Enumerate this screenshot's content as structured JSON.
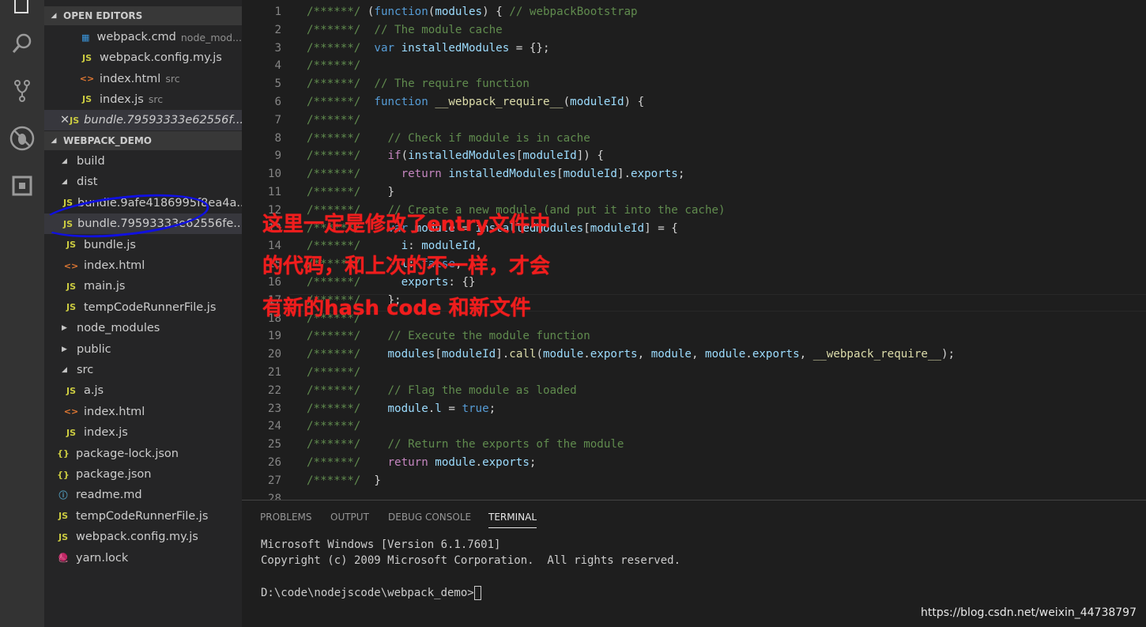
{
  "activity_bar": {
    "icons": [
      "explorer-icon",
      "search-icon",
      "source-control-icon",
      "debug-icon",
      "extensions-icon"
    ]
  },
  "sidebar": {
    "open_editors": {
      "title": "OPEN EDITORS",
      "items": [
        {
          "icon": "windows-icon",
          "name": "webpack.cmd",
          "desc": "node_mod..."
        },
        {
          "icon": "js-icon",
          "name": "webpack.config.my.js",
          "desc": ""
        },
        {
          "icon": "html-icon",
          "name": "index.html",
          "desc": "src"
        },
        {
          "icon": "js-icon",
          "name": "index.js",
          "desc": "src"
        },
        {
          "icon": "js-icon",
          "name": "bundle.79593333e62556f...",
          "desc": "",
          "active": true
        }
      ]
    },
    "project": {
      "title": "WEBPACK_DEMO",
      "items": [
        {
          "type": "folder",
          "name": "build",
          "depth": 1
        },
        {
          "type": "folder",
          "name": "dist",
          "depth": 1
        },
        {
          "type": "js",
          "name": "bundle.9afe4186995f8ea4a...",
          "depth": 2
        },
        {
          "type": "js",
          "name": "bundle.79593333e62556fe...",
          "depth": 2,
          "selected": true
        },
        {
          "type": "js",
          "name": "bundle.js",
          "depth": 2
        },
        {
          "type": "html",
          "name": "index.html",
          "depth": 2
        },
        {
          "type": "js",
          "name": "main.js",
          "depth": 2
        },
        {
          "type": "js",
          "name": "tempCodeRunnerFile.js",
          "depth": 2
        },
        {
          "type": "folder-closed",
          "name": "node_modules",
          "depth": 1
        },
        {
          "type": "folder-closed",
          "name": "public",
          "depth": 1
        },
        {
          "type": "folder",
          "name": "src",
          "depth": 1
        },
        {
          "type": "js",
          "name": "a.js",
          "depth": 2
        },
        {
          "type": "html",
          "name": "index.html",
          "depth": 2
        },
        {
          "type": "js",
          "name": "index.js",
          "depth": 2
        },
        {
          "type": "json",
          "name": "package-lock.json",
          "depth": 1
        },
        {
          "type": "json",
          "name": "package.json",
          "depth": 1
        },
        {
          "type": "info",
          "name": "readme.md",
          "depth": 1
        },
        {
          "type": "js",
          "name": "tempCodeRunnerFile.js",
          "depth": 1
        },
        {
          "type": "js",
          "name": "webpack.config.my.js",
          "depth": 1
        },
        {
          "type": "yarn",
          "name": "yarn.lock",
          "depth": 1
        }
      ]
    }
  },
  "editor": {
    "lines": [
      [
        [
          "c",
          "/******/ "
        ],
        [
          "t",
          "("
        ],
        [
          "k",
          "function"
        ],
        [
          "t",
          "("
        ],
        [
          "v",
          "modules"
        ],
        [
          "t",
          ") { "
        ],
        [
          "c",
          "// webpackBootstrap"
        ]
      ],
      [
        [
          "c",
          "/******/  // The module cache"
        ]
      ],
      [
        [
          "c",
          "/******/  "
        ],
        [
          "k",
          "var"
        ],
        [
          "t",
          " "
        ],
        [
          "v",
          "installedModules"
        ],
        [
          "t",
          " = {};"
        ]
      ],
      [
        [
          "c",
          "/******/"
        ]
      ],
      [
        [
          "c",
          "/******/  // The require function"
        ]
      ],
      [
        [
          "c",
          "/******/  "
        ],
        [
          "k",
          "function"
        ],
        [
          "t",
          " "
        ],
        [
          "f",
          "__webpack_require__"
        ],
        [
          "t",
          "("
        ],
        [
          "v",
          "moduleId"
        ],
        [
          "t",
          ") {"
        ]
      ],
      [
        [
          "c",
          "/******/"
        ]
      ],
      [
        [
          "c",
          "/******/    // Check if module is in cache"
        ]
      ],
      [
        [
          "c",
          "/******/    "
        ],
        [
          "p",
          "if"
        ],
        [
          "t",
          "("
        ],
        [
          "v",
          "installedModules"
        ],
        [
          "t",
          "["
        ],
        [
          "v",
          "moduleId"
        ],
        [
          "t",
          "]) {"
        ]
      ],
      [
        [
          "c",
          "/******/      "
        ],
        [
          "p",
          "return"
        ],
        [
          "t",
          " "
        ],
        [
          "v",
          "installedModules"
        ],
        [
          "t",
          "["
        ],
        [
          "v",
          "moduleId"
        ],
        [
          "t",
          "]."
        ],
        [
          "v",
          "exports"
        ],
        [
          "t",
          ";"
        ]
      ],
      [
        [
          "c",
          "/******/    "
        ],
        [
          "t",
          "}"
        ]
      ],
      [
        [
          "c",
          "/******/    // Create a new module (and put it into the cache)"
        ]
      ],
      [
        [
          "c",
          "/******/    "
        ],
        [
          "k",
          "var"
        ],
        [
          "t",
          " "
        ],
        [
          "v",
          "module"
        ],
        [
          "t",
          " = "
        ],
        [
          "v",
          "installedModules"
        ],
        [
          "t",
          "["
        ],
        [
          "v",
          "moduleId"
        ],
        [
          "t",
          "] = {"
        ]
      ],
      [
        [
          "c",
          "/******/      "
        ],
        [
          "v",
          "i"
        ],
        [
          "t",
          ": "
        ],
        [
          "v",
          "moduleId"
        ],
        [
          "t",
          ","
        ]
      ],
      [
        [
          "c",
          "/******/      "
        ],
        [
          "v",
          "l"
        ],
        [
          "t",
          ": "
        ],
        [
          "k",
          "false"
        ],
        [
          "t",
          ","
        ]
      ],
      [
        [
          "c",
          "/******/      "
        ],
        [
          "v",
          "exports"
        ],
        [
          "t",
          ": {}"
        ]
      ],
      [
        [
          "c",
          "/******/    "
        ],
        [
          "t",
          "};"
        ]
      ],
      [
        [
          "c",
          "/******/"
        ]
      ],
      [
        [
          "c",
          "/******/    // Execute the module function"
        ]
      ],
      [
        [
          "c",
          "/******/    "
        ],
        [
          "v",
          "modules"
        ],
        [
          "t",
          "["
        ],
        [
          "v",
          "moduleId"
        ],
        [
          "t",
          "]."
        ],
        [
          "f",
          "call"
        ],
        [
          "t",
          "("
        ],
        [
          "v",
          "module"
        ],
        [
          "t",
          "."
        ],
        [
          "v",
          "exports"
        ],
        [
          "t",
          ", "
        ],
        [
          "v",
          "module"
        ],
        [
          "t",
          ", "
        ],
        [
          "v",
          "module"
        ],
        [
          "t",
          "."
        ],
        [
          "v",
          "exports"
        ],
        [
          "t",
          ", "
        ],
        [
          "f",
          "__webpack_require__"
        ],
        [
          "t",
          ");"
        ]
      ],
      [
        [
          "c",
          "/******/"
        ]
      ],
      [
        [
          "c",
          "/******/    // Flag the module as loaded"
        ]
      ],
      [
        [
          "c",
          "/******/    "
        ],
        [
          "v",
          "module"
        ],
        [
          "t",
          "."
        ],
        [
          "v",
          "l"
        ],
        [
          "t",
          " = "
        ],
        [
          "k",
          "true"
        ],
        [
          "t",
          ";"
        ]
      ],
      [
        [
          "c",
          "/******/"
        ]
      ],
      [
        [
          "c",
          "/******/    // Return the exports of the module"
        ]
      ],
      [
        [
          "c",
          "/******/    "
        ],
        [
          "p",
          "return"
        ],
        [
          "t",
          " "
        ],
        [
          "v",
          "module"
        ],
        [
          "t",
          "."
        ],
        [
          "v",
          "exports"
        ],
        [
          "t",
          ";"
        ]
      ],
      [
        [
          "c",
          "/******/  "
        ],
        [
          "t",
          "}"
        ]
      ]
    ]
  },
  "panel": {
    "tabs": [
      "PROBLEMS",
      "OUTPUT",
      "DEBUG CONSOLE",
      "TERMINAL"
    ],
    "active_tab": "TERMINAL",
    "terminal": [
      "Microsoft Windows [Version 6.1.7601]",
      "Copyright (c) 2009 Microsoft Corporation.  All rights reserved.",
      "",
      "D:\\code\\nodejscode\\webpack_demo>"
    ]
  },
  "annotation": [
    "这里一定是修改了entry文件中",
    "的代码，和上次的不一样，才会",
    "有新的hash code 和新文件"
  ],
  "watermark": "https://blog.csdn.net/weixin_44738797"
}
